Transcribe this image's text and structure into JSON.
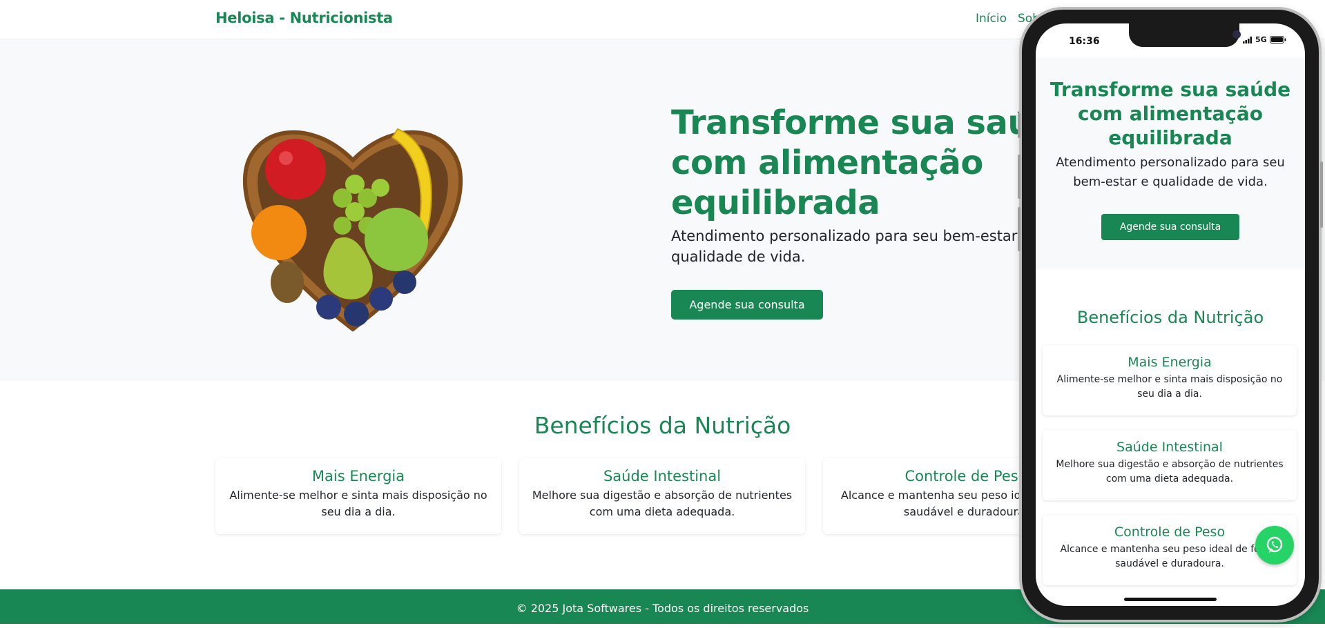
{
  "navbar": {
    "brand": "Heloisa - Nutricionista",
    "links": [
      "Início",
      "Sobre"
    ]
  },
  "hero": {
    "title": "Transforme sua saúde com alimentação equilibrada",
    "subtitle": "Atendimento personalizado para seu bem-estar e qualidade de vida.",
    "cta": "Agende sua consulta",
    "image_icon": "heart-fruit-basket-icon"
  },
  "benefits": {
    "title": "Benefícios da Nutrição",
    "cards": [
      {
        "title": "Mais Energia",
        "text": "Alimente-se melhor e sinta mais disposição no seu dia a dia."
      },
      {
        "title": "Saúde Intestinal",
        "text": "Melhore sua digestão e absorção de nutrientes com uma dieta adequada."
      },
      {
        "title": "Controle de Peso",
        "text": "Alcance e mantenha seu peso ideal de forma saudável e duradoura."
      }
    ]
  },
  "footer": {
    "text": "© 2025 Jota Softwares - Todos os direitos reservados"
  },
  "mobile": {
    "status_time": "16:36",
    "network": "5G",
    "whatsapp_icon": "whatsapp-icon"
  },
  "colors": {
    "brand": "#198754",
    "hero_bg": "#f8f9fa",
    "whatsapp": "#25d366"
  }
}
